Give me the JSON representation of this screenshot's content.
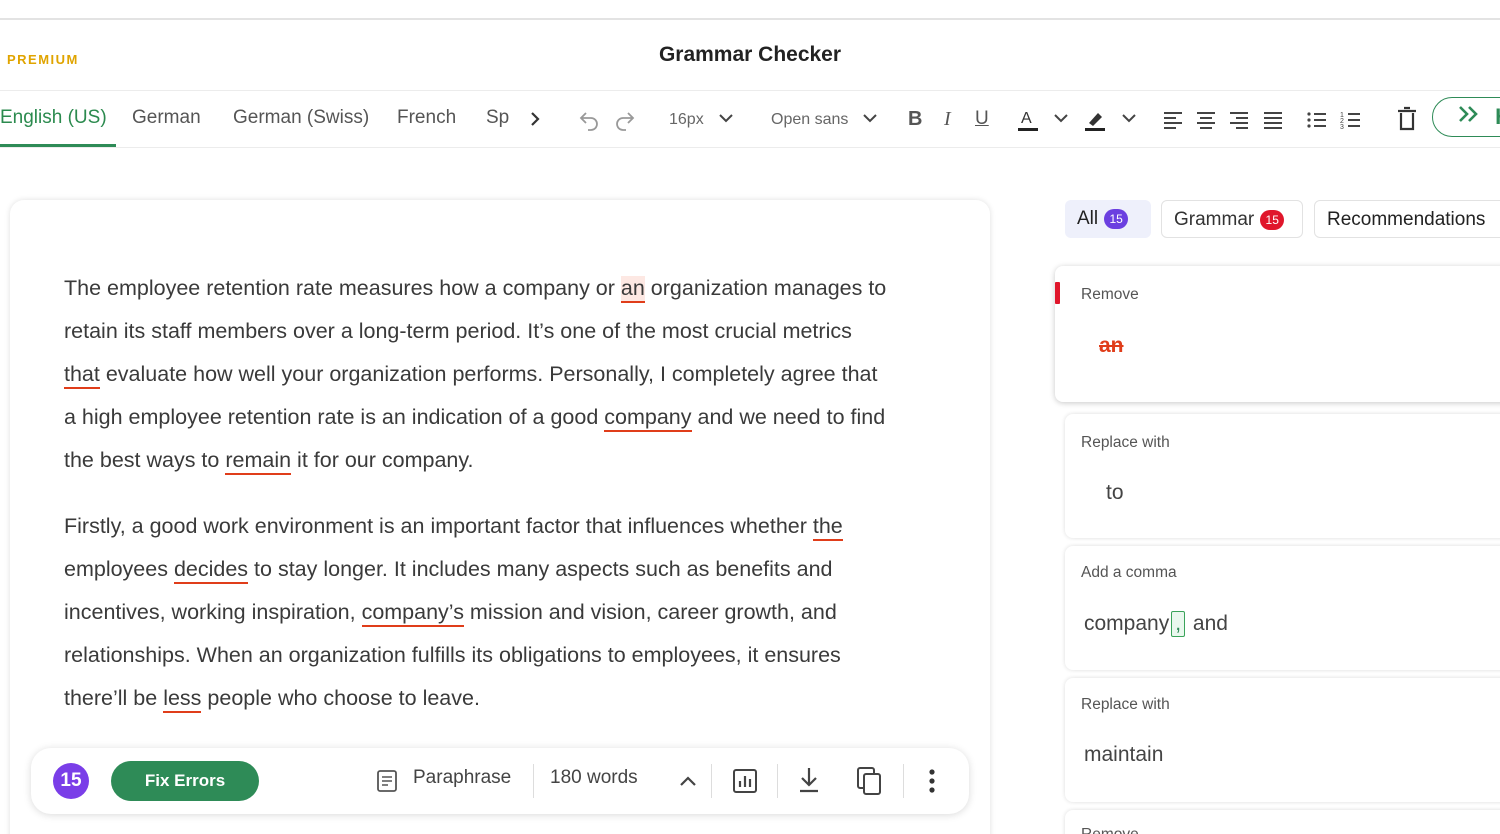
{
  "header": {
    "premium_label": "PREMIUM",
    "title": "Grammar Checker"
  },
  "languages": {
    "tabs": [
      "English (US)",
      "German",
      "German (Swiss)",
      "French",
      "Sp"
    ],
    "active": "English (US)"
  },
  "formatting": {
    "font_size": "16px",
    "font_family": "Open sans",
    "humanize_label": "H"
  },
  "editor": {
    "paragraph1": [
      {
        "pre": "The employee retention rate measures how a company or ",
        "err": "an",
        "post": " organization manages to"
      },
      {
        "pre": "retain its staff members over a long-term period. It’s one of the most crucial metrics",
        "err": "",
        "post": ""
      },
      {
        "pre": "",
        "err": "that",
        "post": " evaluate how well your organization performs. Personally, I completely agree that"
      },
      {
        "pre": "a high employee retention rate is an indication of a good ",
        "err": "company",
        "post": " and we need to find"
      },
      {
        "pre": "the best ways to ",
        "err": "remain",
        "post": " it for our company."
      }
    ],
    "paragraph2": [
      {
        "pre": "Firstly, a good work environment is an important factor that influences whether ",
        "err": "the",
        "post": ""
      },
      {
        "pre": "employees ",
        "err": "decides",
        "post": " to stay longer. It includes many aspects such as benefits and"
      },
      {
        "pre": "incentives, working inspiration, ",
        "err": "company’s",
        "post": " mission and vision, career growth, and"
      },
      {
        "pre": "relationships. When an organization fulfills its obligations to employees, it ensures",
        "err": "",
        "post": ""
      },
      {
        "pre": "there’ll be ",
        "err": "less",
        "post": " people who choose to leave."
      }
    ]
  },
  "bottom_bar": {
    "error_count": "15",
    "fix_button": "Fix Errors",
    "paraphrase_label": "Paraphrase",
    "word_count": "180 words"
  },
  "filters": {
    "all_label": "All",
    "all_count": "15",
    "grammar_label": "Grammar",
    "grammar_count": "15",
    "recommendations_label": "Recommendations"
  },
  "suggestions": [
    {
      "label": "Remove",
      "value": "an"
    },
    {
      "label": "Replace with",
      "value": "to"
    },
    {
      "label": "Add a comma",
      "before": "company",
      "insert": ",",
      "after": "and"
    },
    {
      "label": "Replace with",
      "value": "maintain"
    },
    {
      "label": "Remove",
      "value": ""
    }
  ],
  "colors": {
    "accent_green": "#2e8b57",
    "error_red": "#e03d1a",
    "premium_gold": "#e0a400",
    "count_purple": "#7a3ee8"
  }
}
